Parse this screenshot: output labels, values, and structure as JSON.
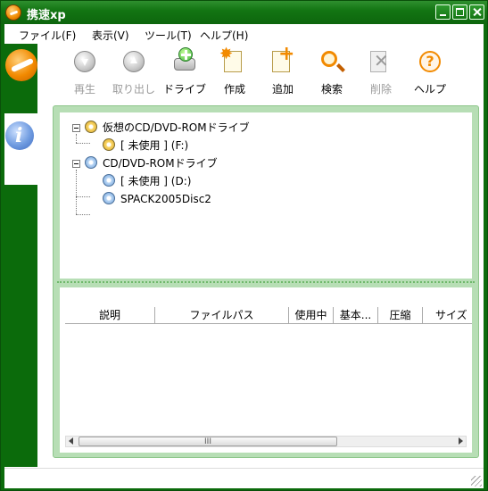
{
  "window": {
    "title": "携速xp"
  },
  "menu": [
    "ファイル(F)",
    "表示(V)",
    "ツール(T)",
    "ヘルプ(H)"
  ],
  "toolbar": [
    {
      "label": "再生",
      "icon": "play-icon",
      "enabled": false
    },
    {
      "label": "取り出し",
      "icon": "eject-icon",
      "enabled": false
    },
    {
      "label": "ドライブ",
      "icon": "add-drive-icon",
      "enabled": true
    },
    {
      "label": "作成",
      "icon": "create-icon",
      "enabled": true
    },
    {
      "label": "追加",
      "icon": "add-icon",
      "enabled": true
    },
    {
      "label": "検索",
      "icon": "search-icon",
      "enabled": true
    },
    {
      "label": "削除",
      "icon": "delete-icon",
      "enabled": false
    },
    {
      "label": "ヘルプ",
      "icon": "help-icon",
      "enabled": true
    }
  ],
  "tree": {
    "virtual_root": "仮想のCD/DVD-ROMドライブ",
    "virtual_child": "[ 未使用 ] (F:)",
    "physical_root": "CD/DVD-ROMドライブ",
    "physical_child_1": "[ 未使用 ] (D:)",
    "physical_child_2": "SPACK2005Disc2"
  },
  "list": {
    "columns": [
      "説明",
      "ファイルパス",
      "使用中",
      "基本...",
      "圧縮",
      "サイズ"
    ],
    "rows": []
  },
  "scrollbar": {
    "thumb_grip": "III"
  },
  "colors": {
    "frame": "#0b6b0b",
    "panel": "#b7deb5",
    "accent": "#f28a00"
  }
}
